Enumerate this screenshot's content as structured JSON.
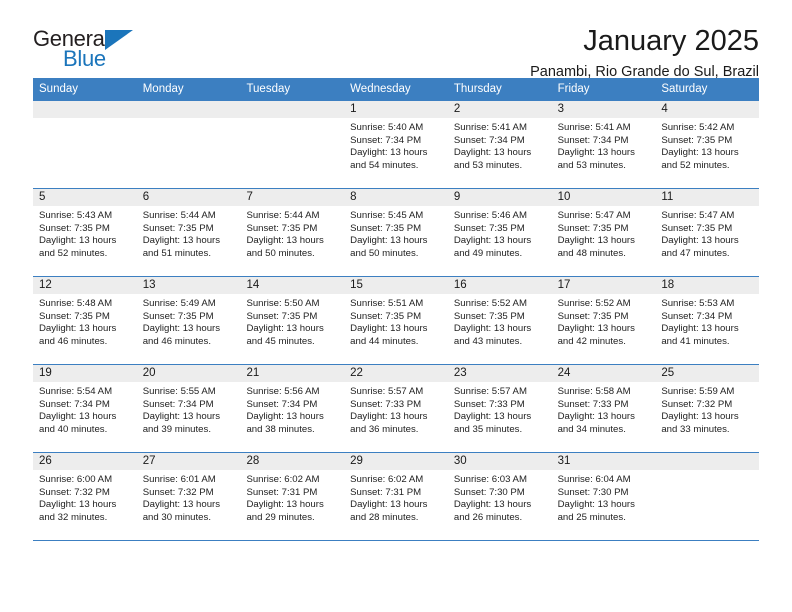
{
  "logo": {
    "word_one": "General",
    "word_two": "Blue",
    "triangle_color": "#1b75bb"
  },
  "header": {
    "title": "January 2025",
    "subtitle": "Panambi, Rio Grande do Sul, Brazil"
  },
  "theme": {
    "header_blue": "#3c7fc1",
    "day_band_gray": "#ededed",
    "text": "#1a1a1a"
  },
  "weekdays": [
    "Sunday",
    "Monday",
    "Tuesday",
    "Wednesday",
    "Thursday",
    "Friday",
    "Saturday"
  ],
  "weeks": [
    [
      {
        "day": "",
        "sunrise": "",
        "sunset": "",
        "daylight1": "",
        "daylight2": ""
      },
      {
        "day": "",
        "sunrise": "",
        "sunset": "",
        "daylight1": "",
        "daylight2": ""
      },
      {
        "day": "",
        "sunrise": "",
        "sunset": "",
        "daylight1": "",
        "daylight2": ""
      },
      {
        "day": "1",
        "sunrise": "Sunrise: 5:40 AM",
        "sunset": "Sunset: 7:34 PM",
        "daylight1": "Daylight: 13 hours",
        "daylight2": "and 54 minutes."
      },
      {
        "day": "2",
        "sunrise": "Sunrise: 5:41 AM",
        "sunset": "Sunset: 7:34 PM",
        "daylight1": "Daylight: 13 hours",
        "daylight2": "and 53 minutes."
      },
      {
        "day": "3",
        "sunrise": "Sunrise: 5:41 AM",
        "sunset": "Sunset: 7:34 PM",
        "daylight1": "Daylight: 13 hours",
        "daylight2": "and 53 minutes."
      },
      {
        "day": "4",
        "sunrise": "Sunrise: 5:42 AM",
        "sunset": "Sunset: 7:35 PM",
        "daylight1": "Daylight: 13 hours",
        "daylight2": "and 52 minutes."
      }
    ],
    [
      {
        "day": "5",
        "sunrise": "Sunrise: 5:43 AM",
        "sunset": "Sunset: 7:35 PM",
        "daylight1": "Daylight: 13 hours",
        "daylight2": "and 52 minutes."
      },
      {
        "day": "6",
        "sunrise": "Sunrise: 5:44 AM",
        "sunset": "Sunset: 7:35 PM",
        "daylight1": "Daylight: 13 hours",
        "daylight2": "and 51 minutes."
      },
      {
        "day": "7",
        "sunrise": "Sunrise: 5:44 AM",
        "sunset": "Sunset: 7:35 PM",
        "daylight1": "Daylight: 13 hours",
        "daylight2": "and 50 minutes."
      },
      {
        "day": "8",
        "sunrise": "Sunrise: 5:45 AM",
        "sunset": "Sunset: 7:35 PM",
        "daylight1": "Daylight: 13 hours",
        "daylight2": "and 50 minutes."
      },
      {
        "day": "9",
        "sunrise": "Sunrise: 5:46 AM",
        "sunset": "Sunset: 7:35 PM",
        "daylight1": "Daylight: 13 hours",
        "daylight2": "and 49 minutes."
      },
      {
        "day": "10",
        "sunrise": "Sunrise: 5:47 AM",
        "sunset": "Sunset: 7:35 PM",
        "daylight1": "Daylight: 13 hours",
        "daylight2": "and 48 minutes."
      },
      {
        "day": "11",
        "sunrise": "Sunrise: 5:47 AM",
        "sunset": "Sunset: 7:35 PM",
        "daylight1": "Daylight: 13 hours",
        "daylight2": "and 47 minutes."
      }
    ],
    [
      {
        "day": "12",
        "sunrise": "Sunrise: 5:48 AM",
        "sunset": "Sunset: 7:35 PM",
        "daylight1": "Daylight: 13 hours",
        "daylight2": "and 46 minutes."
      },
      {
        "day": "13",
        "sunrise": "Sunrise: 5:49 AM",
        "sunset": "Sunset: 7:35 PM",
        "daylight1": "Daylight: 13 hours",
        "daylight2": "and 46 minutes."
      },
      {
        "day": "14",
        "sunrise": "Sunrise: 5:50 AM",
        "sunset": "Sunset: 7:35 PM",
        "daylight1": "Daylight: 13 hours",
        "daylight2": "and 45 minutes."
      },
      {
        "day": "15",
        "sunrise": "Sunrise: 5:51 AM",
        "sunset": "Sunset: 7:35 PM",
        "daylight1": "Daylight: 13 hours",
        "daylight2": "and 44 minutes."
      },
      {
        "day": "16",
        "sunrise": "Sunrise: 5:52 AM",
        "sunset": "Sunset: 7:35 PM",
        "daylight1": "Daylight: 13 hours",
        "daylight2": "and 43 minutes."
      },
      {
        "day": "17",
        "sunrise": "Sunrise: 5:52 AM",
        "sunset": "Sunset: 7:35 PM",
        "daylight1": "Daylight: 13 hours",
        "daylight2": "and 42 minutes."
      },
      {
        "day": "18",
        "sunrise": "Sunrise: 5:53 AM",
        "sunset": "Sunset: 7:34 PM",
        "daylight1": "Daylight: 13 hours",
        "daylight2": "and 41 minutes."
      }
    ],
    [
      {
        "day": "19",
        "sunrise": "Sunrise: 5:54 AM",
        "sunset": "Sunset: 7:34 PM",
        "daylight1": "Daylight: 13 hours",
        "daylight2": "and 40 minutes."
      },
      {
        "day": "20",
        "sunrise": "Sunrise: 5:55 AM",
        "sunset": "Sunset: 7:34 PM",
        "daylight1": "Daylight: 13 hours",
        "daylight2": "and 39 minutes."
      },
      {
        "day": "21",
        "sunrise": "Sunrise: 5:56 AM",
        "sunset": "Sunset: 7:34 PM",
        "daylight1": "Daylight: 13 hours",
        "daylight2": "and 38 minutes."
      },
      {
        "day": "22",
        "sunrise": "Sunrise: 5:57 AM",
        "sunset": "Sunset: 7:33 PM",
        "daylight1": "Daylight: 13 hours",
        "daylight2": "and 36 minutes."
      },
      {
        "day": "23",
        "sunrise": "Sunrise: 5:57 AM",
        "sunset": "Sunset: 7:33 PM",
        "daylight1": "Daylight: 13 hours",
        "daylight2": "and 35 minutes."
      },
      {
        "day": "24",
        "sunrise": "Sunrise: 5:58 AM",
        "sunset": "Sunset: 7:33 PM",
        "daylight1": "Daylight: 13 hours",
        "daylight2": "and 34 minutes."
      },
      {
        "day": "25",
        "sunrise": "Sunrise: 5:59 AM",
        "sunset": "Sunset: 7:32 PM",
        "daylight1": "Daylight: 13 hours",
        "daylight2": "and 33 minutes."
      }
    ],
    [
      {
        "day": "26",
        "sunrise": "Sunrise: 6:00 AM",
        "sunset": "Sunset: 7:32 PM",
        "daylight1": "Daylight: 13 hours",
        "daylight2": "and 32 minutes."
      },
      {
        "day": "27",
        "sunrise": "Sunrise: 6:01 AM",
        "sunset": "Sunset: 7:32 PM",
        "daylight1": "Daylight: 13 hours",
        "daylight2": "and 30 minutes."
      },
      {
        "day": "28",
        "sunrise": "Sunrise: 6:02 AM",
        "sunset": "Sunset: 7:31 PM",
        "daylight1": "Daylight: 13 hours",
        "daylight2": "and 29 minutes."
      },
      {
        "day": "29",
        "sunrise": "Sunrise: 6:02 AM",
        "sunset": "Sunset: 7:31 PM",
        "daylight1": "Daylight: 13 hours",
        "daylight2": "and 28 minutes."
      },
      {
        "day": "30",
        "sunrise": "Sunrise: 6:03 AM",
        "sunset": "Sunset: 7:30 PM",
        "daylight1": "Daylight: 13 hours",
        "daylight2": "and 26 minutes."
      },
      {
        "day": "31",
        "sunrise": "Sunrise: 6:04 AM",
        "sunset": "Sunset: 7:30 PM",
        "daylight1": "Daylight: 13 hours",
        "daylight2": "and 25 minutes."
      },
      {
        "day": "",
        "sunrise": "",
        "sunset": "",
        "daylight1": "",
        "daylight2": ""
      }
    ]
  ]
}
